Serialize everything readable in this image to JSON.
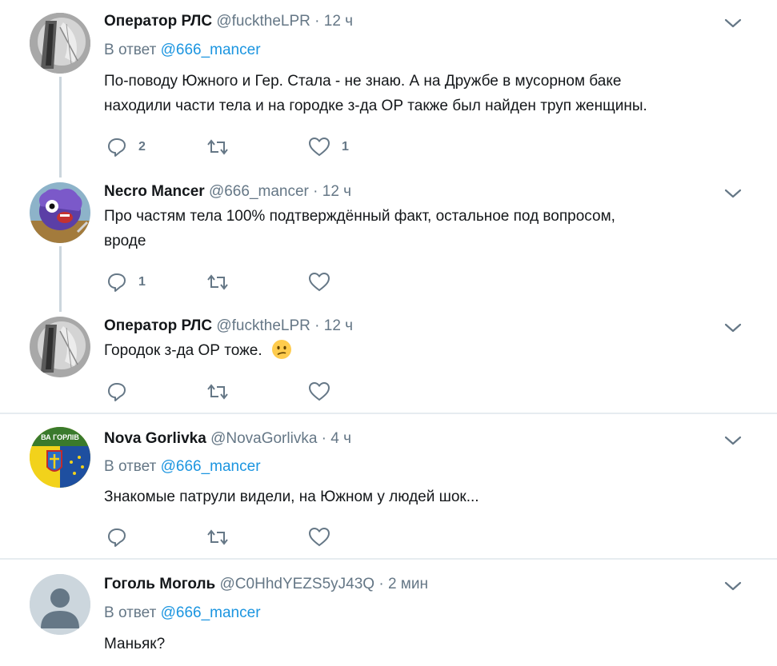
{
  "tweets": [
    {
      "name": "Оператор РЛС",
      "handle": "@fucktheLPR",
      "sep": "·",
      "time": "12 ч",
      "reply_prefix": "В ответ",
      "reply_to": "@666_mancer",
      "text_lines": [
        "По-поводу Южного и Гер. Стала - не знаю. А на Дружбе в мусорном баке",
        "находили части тела и на городке з-да ОР также был найден труп женщины."
      ],
      "reply_count": "2",
      "retweet_count": "",
      "like_count": "1"
    },
    {
      "name": "Necro Mancer",
      "handle": "@666_mancer",
      "sep": "·",
      "time": "12 ч",
      "text_lines": [
        "Про частям тела 100% подтверждённый факт, остальное под вопросом,",
        "вроде"
      ],
      "reply_count": "1",
      "retweet_count": "",
      "like_count": ""
    },
    {
      "name": "Оператор РЛС",
      "handle": "@fucktheLPR",
      "sep": "·",
      "time": "12 ч",
      "text_lines": [
        "Городок з-да ОР тоже."
      ],
      "emoji": "confused-face",
      "reply_count": "",
      "retweet_count": "",
      "like_count": ""
    },
    {
      "name": "Nova Gorlivka",
      "handle": "@NovaGorlivka",
      "sep": "·",
      "time": "4 ч",
      "reply_prefix": "В ответ",
      "reply_to": "@666_mancer",
      "text_lines": [
        "Знакомые патрули видели, на Южном у людей шок..."
      ],
      "reply_count": "",
      "retweet_count": "",
      "like_count": ""
    },
    {
      "name": "Гоголь Моголь",
      "handle": "@C0HhdYEZS5yJ43Q",
      "sep": "·",
      "time": "2 мин",
      "reply_prefix": "В ответ",
      "reply_to": "@666_mancer",
      "text_lines": [
        "Маньяк?"
      ]
    }
  ],
  "colors": {
    "text": "#14171a",
    "secondary": "#657786",
    "link": "#1b95e0",
    "thread_line": "#ccd6dd",
    "divider": "#e6ecf0"
  },
  "icons": {
    "reply": "reply-icon",
    "retweet": "retweet-icon",
    "like": "heart-icon",
    "more": "chevron-down-icon"
  }
}
